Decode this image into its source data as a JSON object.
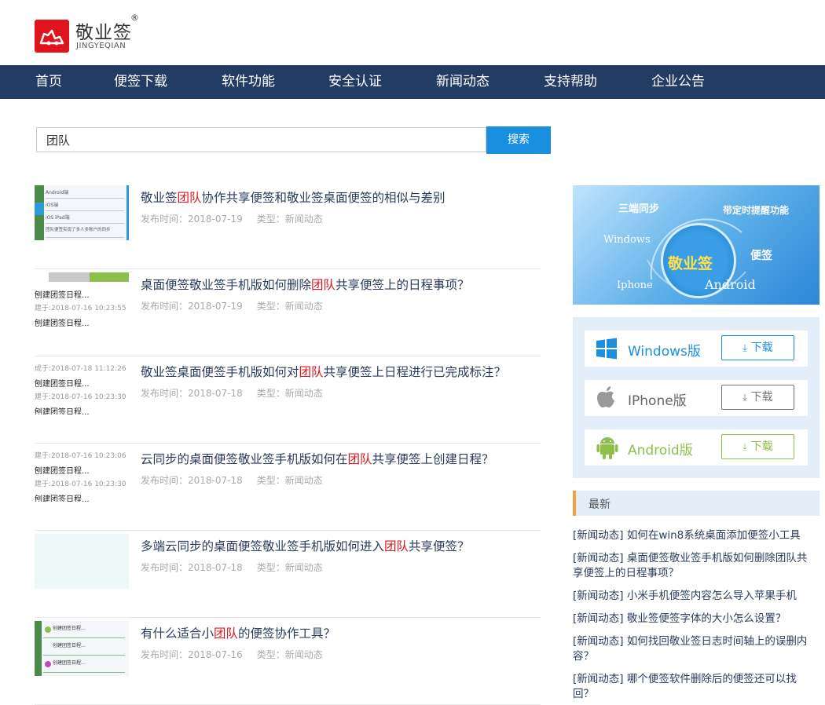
{
  "header": {
    "logo_cn": "敬业签",
    "logo_reg": "®",
    "logo_en": "JINGYEQIAN"
  },
  "nav": [
    "首页",
    "便签下载",
    "软件功能",
    "安全认证",
    "新闻动态",
    "支持帮助",
    "企业公告"
  ],
  "search": {
    "value": "团队",
    "button": "搜索"
  },
  "articles": [
    {
      "pre": "敬业签",
      "hl": "团队",
      "post": "协作共享便签和敬业签桌面便签的相似与差别",
      "date": "发布时间：2018-07-19",
      "type": "类型：新闻动态"
    },
    {
      "pre": "桌面便签敬业签手机版如何删除",
      "hl": "团队",
      "post": "共享便签上的日程事项？",
      "date": "发布时间：2018-07-19",
      "type": "类型：新闻动态"
    },
    {
      "pre": "敬业签桌面便签手机版如何对",
      "hl": "团队",
      "post": "共享便签上日程进行已完成标注？",
      "date": "发布时间：2018-07-18",
      "type": "类型：新闻动态"
    },
    {
      "pre": "云同步的桌面便签敬业签手机版如何在",
      "hl": "团队",
      "post": "共享便签上创建日程？",
      "date": "发布时间：2018-07-18",
      "type": "类型：新闻动态"
    },
    {
      "pre": "多端云同步的桌面便签敬业签手机版如何进入",
      "hl": "团队",
      "post": "共享便签？",
      "date": "发布时间：2018-07-18",
      "type": "类型：新闻动态"
    },
    {
      "pre": "有什么适合小",
      "hl": "团队",
      "post": "的便签协作工具？",
      "date": "发布时间：2018-07-16",
      "type": "类型：新闻动态"
    }
  ],
  "thumb_texts": {
    "t1": [
      "Android端",
      "iOS端",
      "iOS iPad端",
      "团队便签实现了多人多账户的同步"
    ],
    "t2": [
      "刨建团签日程...",
      "建于:2018-07-16 10:23:55 (",
      "刨建团签日程..."
    ],
    "t3": [
      "成于:2018-07-18 11:12:26 (",
      "刨建团签日程...",
      "建于:2018-07-16 10:23:30 (",
      "刨建团签日程..."
    ],
    "t4": [
      "建于:2018-07-16 10:23:06 (",
      "刨建团签日程...",
      "建于:2018-07-16 10:23:30 (",
      "刨建团签日程..."
    ],
    "t6": [
      "创建团签日程...",
      "创建团签日程...",
      "创建团签日程..."
    ]
  },
  "banner": {
    "t1": "三端同步",
    "t2": "带定时提醒功能",
    "t3": "Windows",
    "t4": "便签",
    "t5": "Android",
    "t6": "Iphone",
    "brand": "敬业签"
  },
  "downloads": [
    {
      "name": "Windows版",
      "button": "下载",
      "color": "#1a8fe0",
      "icon": "windows-icon"
    },
    {
      "name": "IPhone版",
      "button": "下载",
      "color": "#777777",
      "icon": "apple-icon"
    },
    {
      "name": "Android版",
      "button": "下载",
      "color": "#8cc04a",
      "icon": "android-icon"
    }
  ],
  "latest": {
    "title": "最新",
    "items": [
      "[新闻动态] 如何在win8系统桌面添加便签小工具",
      "[新闻动态] 桌面便签敬业签手机版如何删除团队共享便签上的日程事项？",
      "[新闻动态] 小米手机便签内容怎么导入苹果手机",
      "[新闻动态] 敬业签便签字体的大小怎么设置？",
      "[新闻动态] 如何找回敬业签日志时间轴上的误删内容？",
      "[新闻动态] 哪个便签软件删除后的便签还可以找回？"
    ]
  }
}
